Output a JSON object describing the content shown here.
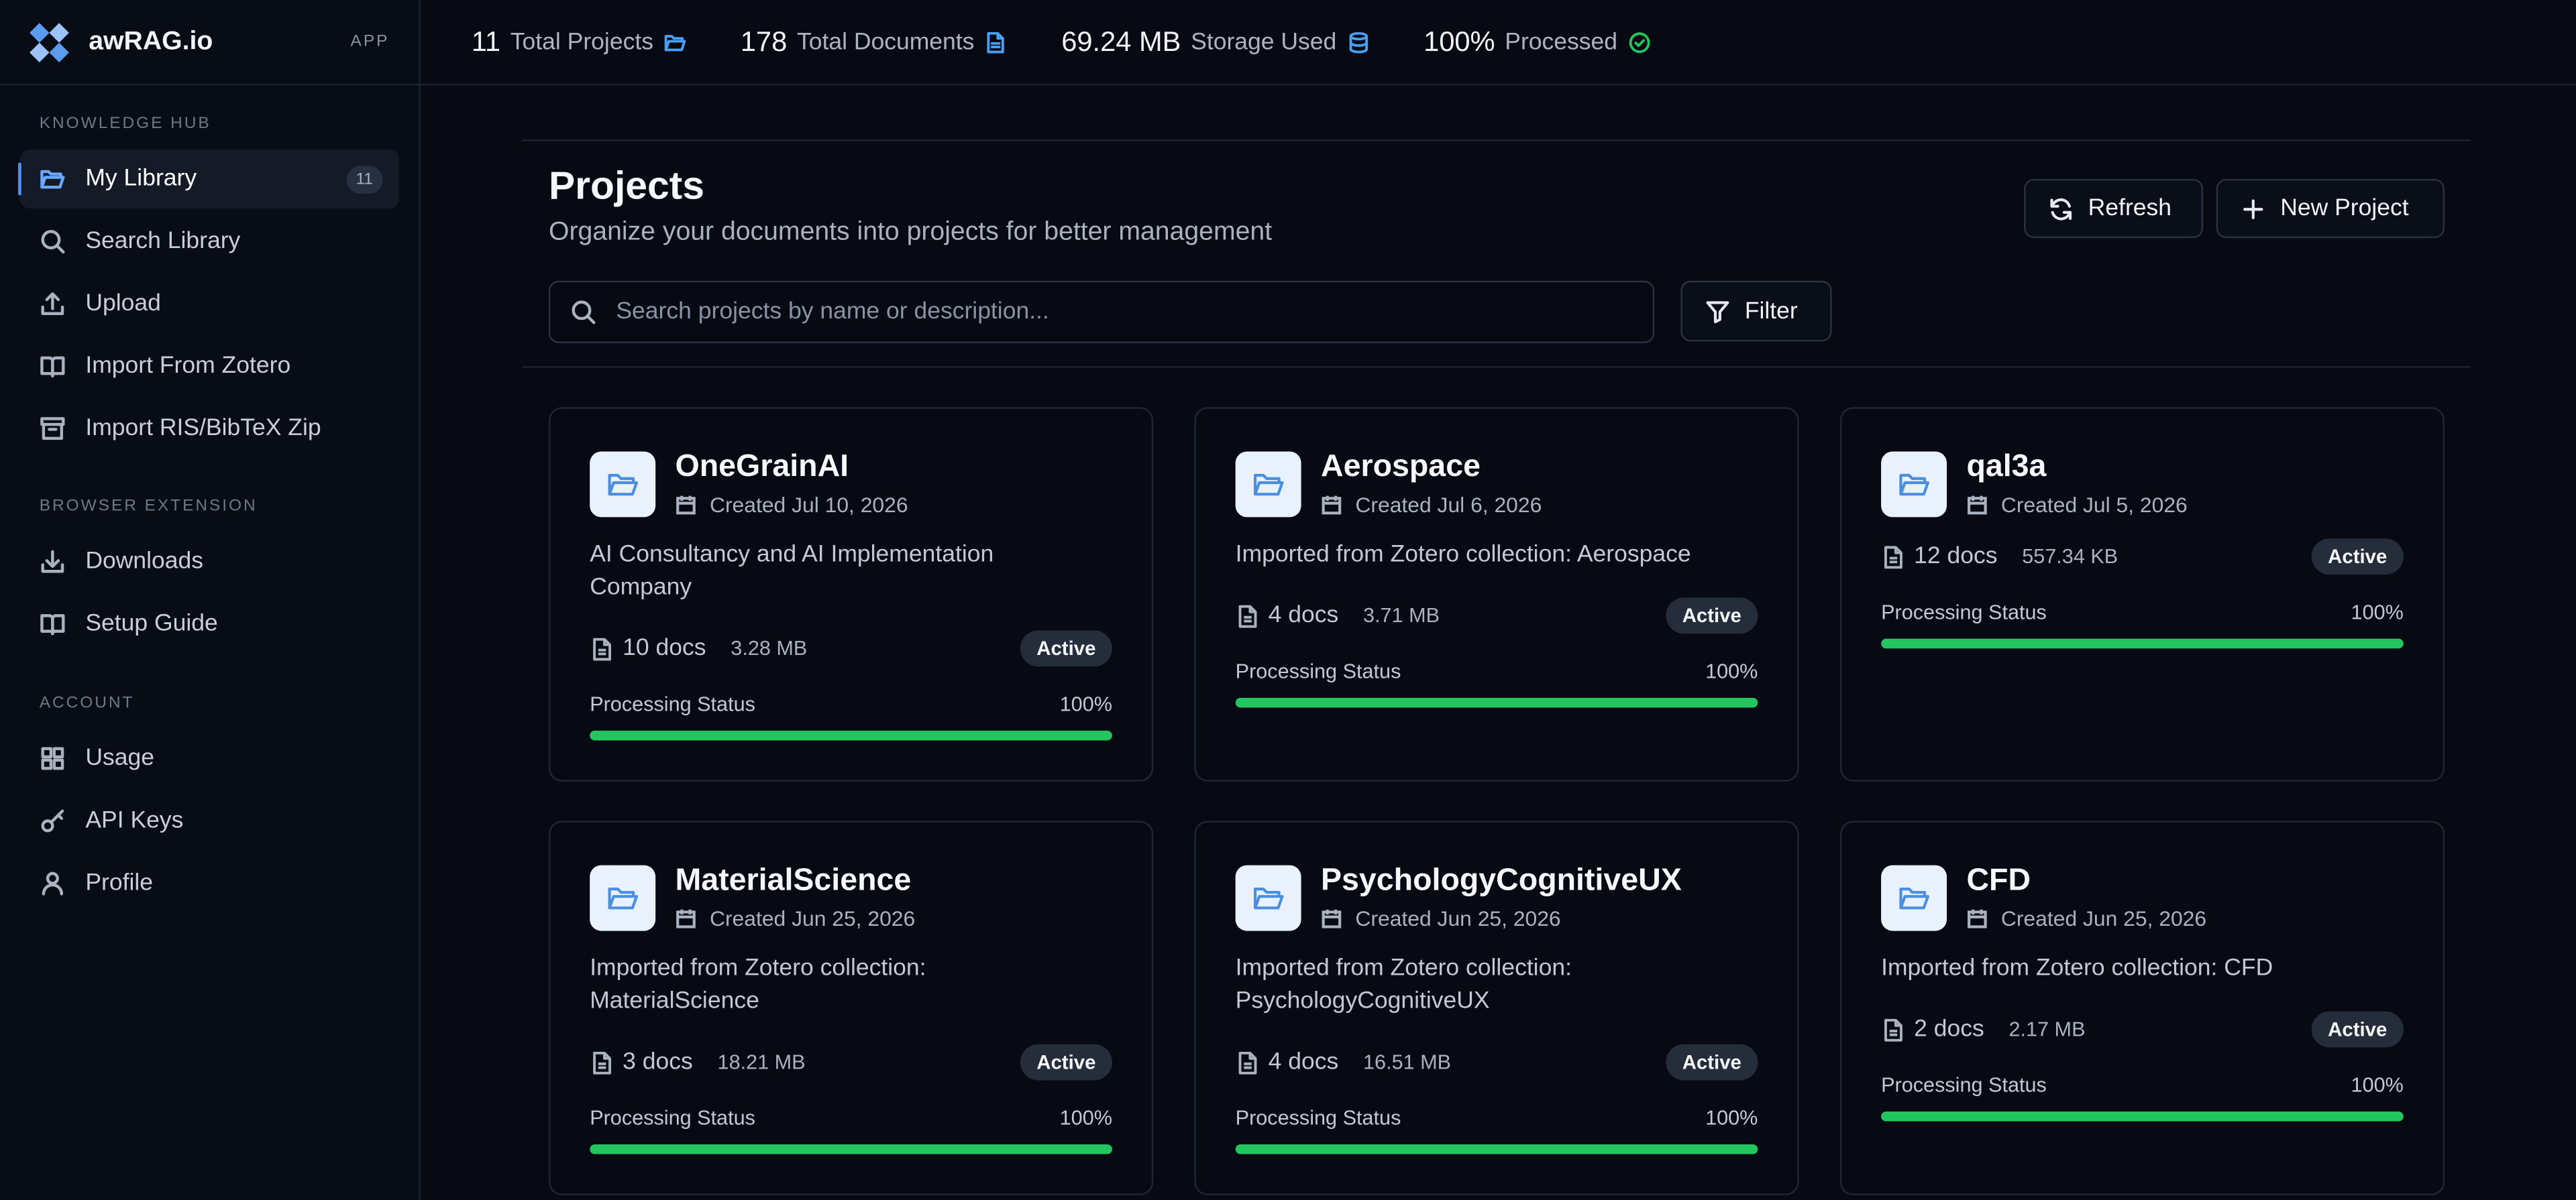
{
  "app": {
    "name": "awRAG.io",
    "tag": "APP"
  },
  "sidebar": {
    "sections": [
      {
        "label": "KNOWLEDGE HUB"
      },
      {
        "label": "BROWSER EXTENSION"
      },
      {
        "label": "ACCOUNT"
      }
    ],
    "items": [
      {
        "label": "My Library",
        "icon": "folder-open-icon",
        "count": "11",
        "active": true
      },
      {
        "label": "Search Library",
        "icon": "search-icon"
      },
      {
        "label": "Upload",
        "icon": "upload-icon"
      },
      {
        "label": "Import From Zotero",
        "icon": "book-open-icon"
      },
      {
        "label": "Import RIS/BibTeX Zip",
        "icon": "archive-icon"
      },
      {
        "label": "Downloads",
        "icon": "download-icon"
      },
      {
        "label": "Setup Guide",
        "icon": "book-open-icon"
      },
      {
        "label": "Usage",
        "icon": "grid-icon"
      },
      {
        "label": "API Keys",
        "icon": "key-icon"
      },
      {
        "label": "Profile",
        "icon": "user-icon"
      }
    ]
  },
  "stats": [
    {
      "value": "11",
      "label": "Total Projects",
      "icon": "folder-icon",
      "color": "#4a9ff5"
    },
    {
      "value": "178",
      "label": "Total Documents",
      "icon": "file-text-icon",
      "color": "#4a9ff5"
    },
    {
      "value": "69.24 MB",
      "label": "Storage Used",
      "icon": "database-icon",
      "color": "#4a9ff5"
    },
    {
      "value": "100%",
      "label": "Processed",
      "icon": "check-circle-icon",
      "color": "#22c55e"
    }
  ],
  "page": {
    "title": "Projects",
    "subtitle": "Organize your documents into projects for better management",
    "refresh_label": "Refresh",
    "new_project_label": "New Project",
    "search_placeholder": "Search projects by name or description...",
    "filter_label": "Filter"
  },
  "projects": [
    {
      "name": "OneGrainAI",
      "created": "Created Jul 10, 2026",
      "description": "AI Consultancy and AI Implementation Company",
      "docs": "10 docs",
      "size": "3.28 MB",
      "status": "Active",
      "processing_label": "Processing Status",
      "progress": "100%",
      "progress_value": 1.0
    },
    {
      "name": "Aerospace",
      "created": "Created Jul 6, 2026",
      "description": "Imported from Zotero collection: Aerospace",
      "docs": "4 docs",
      "size": "3.71 MB",
      "status": "Active",
      "processing_label": "Processing Status",
      "progress": "100%",
      "progress_value": 1.0
    },
    {
      "name": "qal3a",
      "created": "Created Jul 5, 2026",
      "description": "",
      "docs": "12 docs",
      "size": "557.34 KB",
      "status": "Active",
      "processing_label": "Processing Status",
      "progress": "100%",
      "progress_value": 1.0
    },
    {
      "name": "MaterialScience",
      "created": "Created Jun 25, 2026",
      "description": "Imported from Zotero collection: MaterialScience",
      "docs": "3 docs",
      "size": "18.21 MB",
      "status": "Active",
      "processing_label": "Processing Status",
      "progress": "100%",
      "progress_value": 1.0
    },
    {
      "name": "PsychologyCognitiveUX",
      "created": "Created Jun 25, 2026",
      "description": "Imported from Zotero collection: PsychologyCognitiveUX",
      "docs": "4 docs",
      "size": "16.51 MB",
      "status": "Active",
      "processing_label": "Processing Status",
      "progress": "100%",
      "progress_value": 1.0
    },
    {
      "name": "CFD",
      "created": "Created Jun 25, 2026",
      "description": "Imported from Zotero collection: CFD",
      "docs": "2 docs",
      "size": "2.17 MB",
      "status": "Active",
      "processing_label": "Processing Status",
      "progress": "100%",
      "progress_value": 1.0
    }
  ],
  "colors": {
    "accent": "#4b8ff1",
    "progress": "#22c55e",
    "background": "#070a12"
  }
}
